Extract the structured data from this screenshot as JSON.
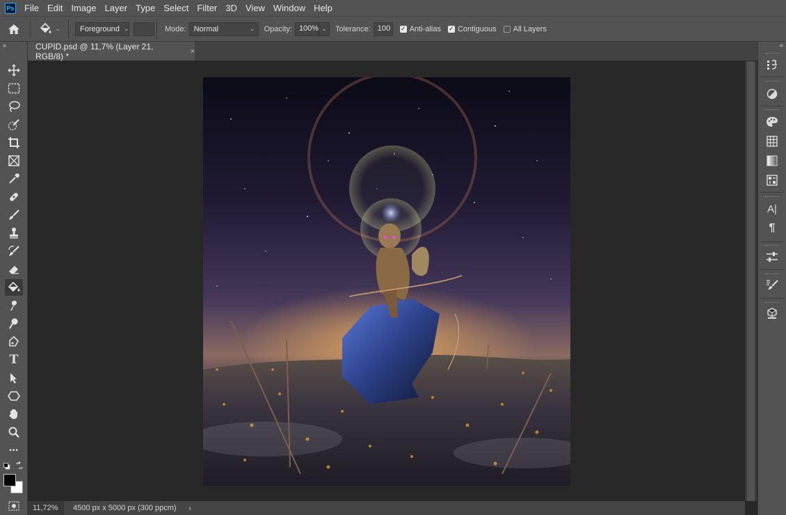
{
  "app": {
    "logo_text": "Ps"
  },
  "menu": [
    "File",
    "Edit",
    "Image",
    "Layer",
    "Type",
    "Select",
    "Filter",
    "3D",
    "View",
    "Window",
    "Help"
  ],
  "options": {
    "fill_source": "Foreground",
    "mode_label": "Mode:",
    "mode_value": "Normal",
    "opacity_label": "Opacity:",
    "opacity_value": "100%",
    "tolerance_label": "Tolerance:",
    "tolerance_value": "100",
    "anti_alias": {
      "label": "Anti-alias",
      "checked": true
    },
    "contiguous": {
      "label": "Contiguous",
      "checked": true
    },
    "all_layers": {
      "label": "All Layers",
      "checked": false
    }
  },
  "document": {
    "tab_title": "CUPID.psd @ 11,7% (Layer 21, RGB/8) *",
    "close_glyph": "×"
  },
  "toolbar": {
    "collapse_glyph": "»",
    "tools": [
      "move",
      "marquee",
      "lasso",
      "quick-selection",
      "crop",
      "frame",
      "eyedropper",
      "healing-brush",
      "brush",
      "clone-stamp",
      "history-brush",
      "eraser",
      "paint-bucket",
      "smudge",
      "dodge",
      "pen",
      "type",
      "path-selection",
      "shape",
      "hand",
      "zoom",
      "more"
    ],
    "active_tool": "paint-bucket",
    "more_glyph": "•••",
    "type_glyph": "T",
    "foreground_color": "#000000",
    "background_color": "#ffffff"
  },
  "status": {
    "zoom": "11,72%",
    "doc_info": "4500 px x 5000 px (300 ppcm)",
    "arrow_glyph": "›"
  },
  "right_panel": {
    "collapse_glyph": "«",
    "icons": [
      "history",
      "adjustments",
      "swatches",
      "grid",
      "gradients",
      "patterns",
      "character",
      "paragraph",
      "properties",
      "brushes",
      "3d"
    ],
    "character_glyph": "A|",
    "paragraph_glyph": "¶"
  },
  "colors": {
    "accent": "#31a8ff",
    "panel": "#535353",
    "canvas_bg": "#282828"
  }
}
